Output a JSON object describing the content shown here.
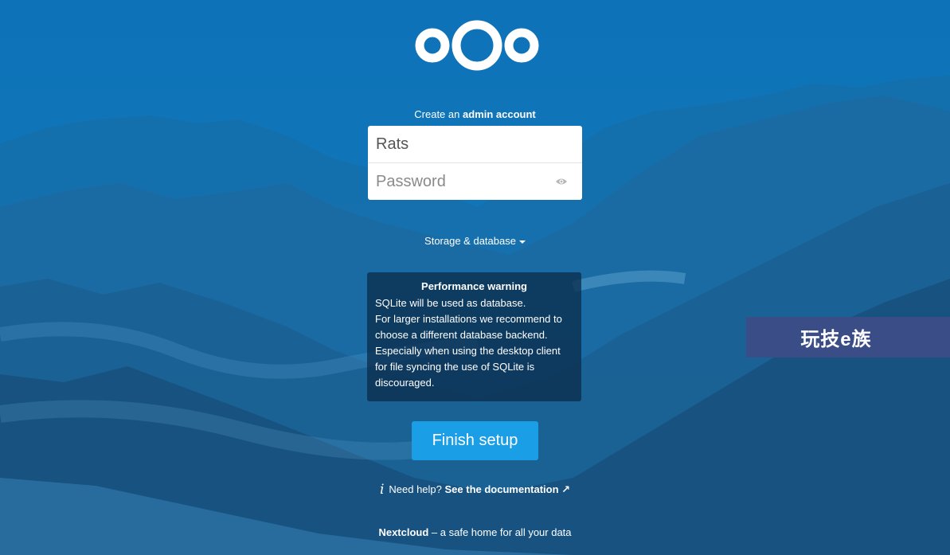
{
  "colors": {
    "background": "#0f6fae",
    "button": "#1a9ee6",
    "warning_bg": "rgba(10,40,70,0.72)",
    "watermark_bg": "#3b4d86"
  },
  "logo": {
    "icon": "nextcloud-logo-icon"
  },
  "heading": {
    "prefix": "Create an",
    "bold": "admin account"
  },
  "form": {
    "username_value": "Rats",
    "password_placeholder": "Password",
    "show_password_icon": "eye-icon"
  },
  "storage": {
    "label": "Storage & database"
  },
  "warning": {
    "title": "Performance warning",
    "lines": [
      "SQLite will be used as database.",
      "For larger installations we recommend to",
      "choose a different database backend.",
      "Especially when using the desktop client",
      "for file syncing the use of SQLite is",
      "discouraged."
    ]
  },
  "finish_button": {
    "label": "Finish setup"
  },
  "help": {
    "prefix": "Need help?",
    "link": "See the documentation ↗",
    "icon": "info-icon"
  },
  "footer": {
    "brand": "Nextcloud",
    "tagline": "– a safe home for all your data"
  },
  "watermark": {
    "text": "玩技e族"
  }
}
